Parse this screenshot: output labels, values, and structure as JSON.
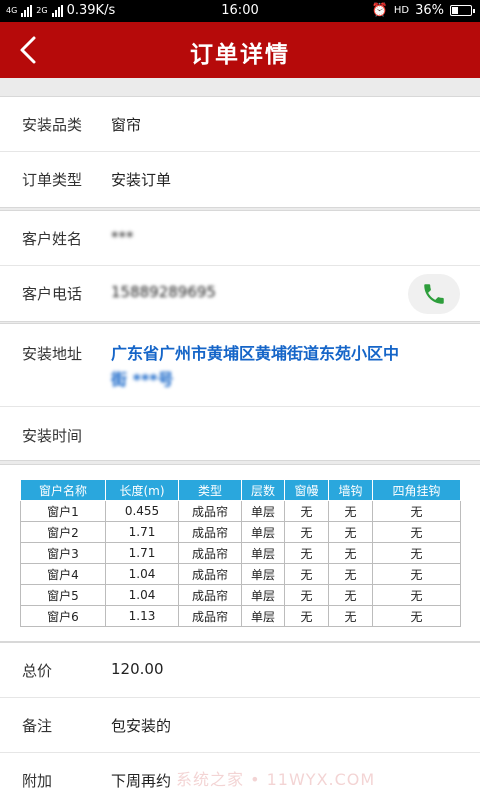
{
  "status_bar": {
    "network": "4G",
    "network2": "2G",
    "speed": "0.39K/s",
    "time": "16:00",
    "hd": "HD",
    "battery": "36%",
    "battery_level": 0.36
  },
  "header": {
    "title": "订单详情"
  },
  "order": {
    "category_label": "安装品类",
    "category_value": "窗帘",
    "type_label": "订单类型",
    "type_value": "安装订单"
  },
  "customer": {
    "name_label": "客户姓名",
    "name_value": "***",
    "phone_label": "客户电话",
    "phone_value": "15889289695"
  },
  "address": {
    "address_label": "安装地址",
    "address_line1": "广东省广州市黄埔区黄埔街道东苑小区中",
    "address_line2": "街 ***号",
    "time_label": "安装时间",
    "time_value": ""
  },
  "table": {
    "headers": [
      "窗户名称",
      "长度(m)",
      "类型",
      "层数",
      "窗幔",
      "墙钩",
      "四角挂钩"
    ],
    "rows": [
      [
        "窗户1",
        "0.455",
        "成品帘",
        "单层",
        "无",
        "无",
        "无"
      ],
      [
        "窗户2",
        "1.71",
        "成品帘",
        "单层",
        "无",
        "无",
        "无"
      ],
      [
        "窗户3",
        "1.71",
        "成品帘",
        "单层",
        "无",
        "无",
        "无"
      ],
      [
        "窗户4",
        "1.04",
        "成品帘",
        "单层",
        "无",
        "无",
        "无"
      ],
      [
        "窗户5",
        "1.04",
        "成品帘",
        "单层",
        "无",
        "无",
        "无"
      ],
      [
        "窗户6",
        "1.13",
        "成品帘",
        "单层",
        "无",
        "无",
        "无"
      ]
    ]
  },
  "summary": {
    "total_label": "总价",
    "total_value": "120.00",
    "note_label": "备注",
    "note_value": "包安装的",
    "extra_label": "附加",
    "extra_value": "下周再约"
  },
  "watermark": "系统之家 • 11WYX.COM",
  "colors": {
    "header": "#b60a0a",
    "link": "#1565c8",
    "table_header": "#2aa7dd",
    "call": "#2e9e3c"
  }
}
